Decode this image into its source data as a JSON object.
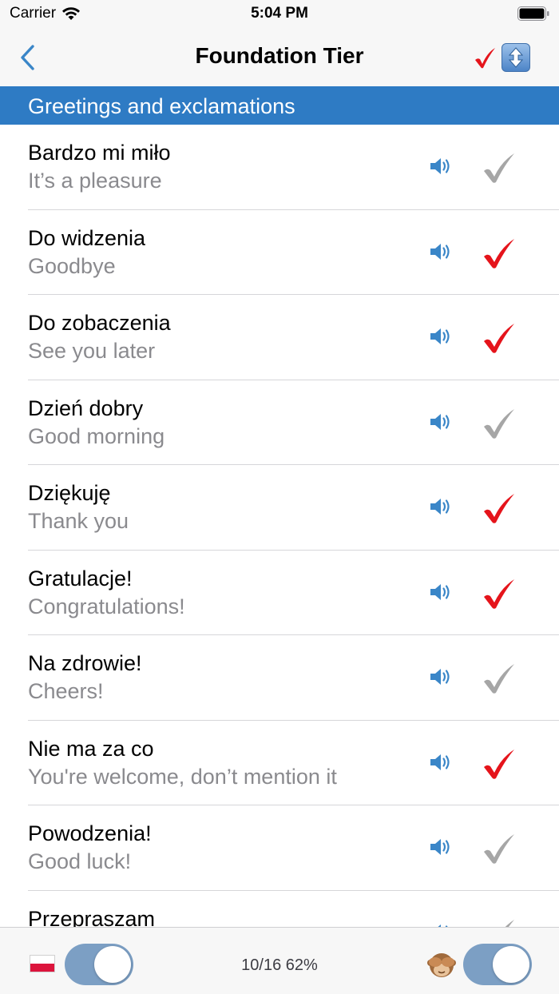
{
  "status_bar": {
    "carrier": "Carrier",
    "time": "5:04 PM",
    "icons": [
      "wifi-icon",
      "battery-icon"
    ]
  },
  "nav": {
    "title": "Foundation Tier",
    "back_icon": "chevron-left-icon",
    "check_icon": "check-icon",
    "sort_icon": "up-down-arrow-icon"
  },
  "section": {
    "title": "Greetings and exclamations"
  },
  "rows": [
    {
      "polish": "Bardzo mi miło",
      "english": "It’s a pleasure",
      "learned": false
    },
    {
      "polish": "Do widzenia",
      "english": "Goodbye",
      "learned": true
    },
    {
      "polish": "Do zobaczenia",
      "english": "See you later",
      "learned": true
    },
    {
      "polish": "Dzień dobry",
      "english": "Good morning",
      "learned": false
    },
    {
      "polish": "Dziękuję",
      "english": "Thank you",
      "learned": true
    },
    {
      "polish": "Gratulacje!",
      "english": "Congratulations!",
      "learned": true
    },
    {
      "polish": "Na zdrowie!",
      "english": "Cheers!",
      "learned": false
    },
    {
      "polish": "Nie ma za co",
      "english": "You're welcome, don’t mention it",
      "learned": true
    },
    {
      "polish": "Powodzenia!",
      "english": "Good luck!",
      "learned": false
    },
    {
      "polish": "Przepraszam",
      "english": "",
      "learned": false
    }
  ],
  "toolbar": {
    "progress_text": "10/16 62%",
    "left_toggle_on": true,
    "right_toggle_on": true,
    "flag_icon": "polish-flag-icon",
    "monkey_icon": "see-no-evil-monkey-icon"
  },
  "colors": {
    "accent_blue": "#2e7bc4",
    "learned_red": "#e5141b",
    "unlearned_gray": "#a6a6a6",
    "speaker_blue": "#3a86c8",
    "toggle_blue": "#7c9fc4"
  }
}
